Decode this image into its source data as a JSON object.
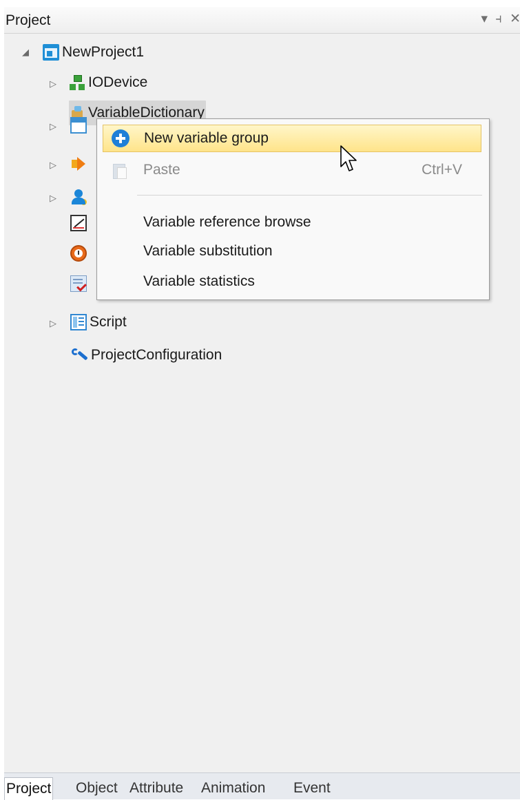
{
  "panel": {
    "title": "Project",
    "buttons": {
      "dropdown": "▾",
      "pin": "⫞",
      "close": "✕"
    }
  },
  "tree": {
    "root": {
      "label": "NewProject1",
      "expander": "◢"
    },
    "items": [
      {
        "label": "IODevice",
        "expander": "▷",
        "icon": "io-device-icon"
      },
      {
        "label": "VariableDictionary",
        "expander": "",
        "icon": "variable-dictionary-icon",
        "selected": true
      },
      {
        "label": "",
        "expander": "▷",
        "icon": "window-icon"
      },
      {
        "label": "",
        "expander": "▷",
        "icon": "alarm-icon"
      },
      {
        "label": "",
        "expander": "▷",
        "icon": "user-icon"
      },
      {
        "label": "",
        "expander": "",
        "icon": "trend-icon"
      },
      {
        "label": "",
        "expander": "",
        "icon": "clock-icon"
      },
      {
        "label": "",
        "expander": "",
        "icon": "report-icon"
      },
      {
        "label": "Script",
        "expander": "▷",
        "icon": "script-icon"
      },
      {
        "label": "ProjectConfiguration",
        "expander": "",
        "icon": "wrench-icon"
      }
    ]
  },
  "context_menu": {
    "items": [
      {
        "label": "New variable group",
        "shortcut": "",
        "highlighted": true
      },
      {
        "label": "Paste",
        "shortcut": "Ctrl+V",
        "disabled": true
      },
      {
        "label": "Variable reference browse",
        "shortcut": ""
      },
      {
        "label": "Variable substitution",
        "shortcut": ""
      },
      {
        "label": "Variable statistics",
        "shortcut": ""
      }
    ]
  },
  "bottom_tabs": [
    {
      "label": "Project",
      "active": true
    },
    {
      "label": "Object"
    },
    {
      "label": "Attribute"
    },
    {
      "label": "Animation"
    },
    {
      "label": "Event"
    }
  ],
  "colors": {
    "accent": "#1e7fd7",
    "highlight": "#ffe48a",
    "panel_bg": "#f0f0f0"
  }
}
